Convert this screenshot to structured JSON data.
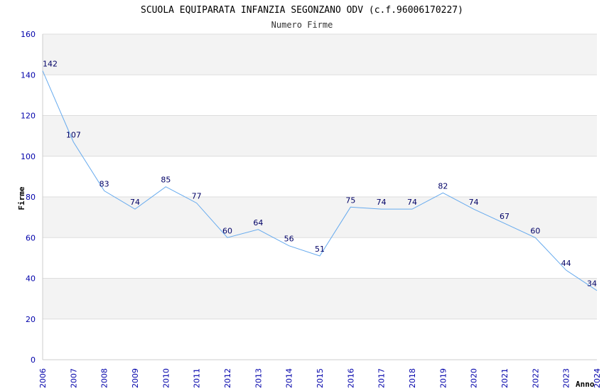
{
  "chart_data": {
    "type": "line",
    "title": "SCUOLA EQUIPARATA INFANZIA SEGONZANO ODV (c.f.96006170227)",
    "subtitle": "Numero Firme",
    "xlabel": "Anno",
    "ylabel": "Firme",
    "x": [
      "2006",
      "2007",
      "2008",
      "2009",
      "2010",
      "2011",
      "2012",
      "2013",
      "2014",
      "2015",
      "2016",
      "2017",
      "2018",
      "2019",
      "2020",
      "2021",
      "2022",
      "2023",
      "2024"
    ],
    "series": [
      {
        "values": [
          142,
          107,
          83,
          74,
          85,
          77,
          60,
          64,
          56,
          51,
          75,
          74,
          74,
          82,
          74,
          67,
          60,
          44,
          34
        ]
      }
    ],
    "ylim": [
      0,
      160
    ],
    "yticks": [
      0,
      20,
      40,
      60,
      80,
      100,
      120,
      140,
      160
    ],
    "grid": "horizontal bands",
    "legend": "none",
    "colors": {
      "line": "#66aaee",
      "band": "#f3f3f3",
      "gridline": "#dddddd",
      "tick_text": "#0000aa",
      "data_label": "#000066"
    }
  }
}
